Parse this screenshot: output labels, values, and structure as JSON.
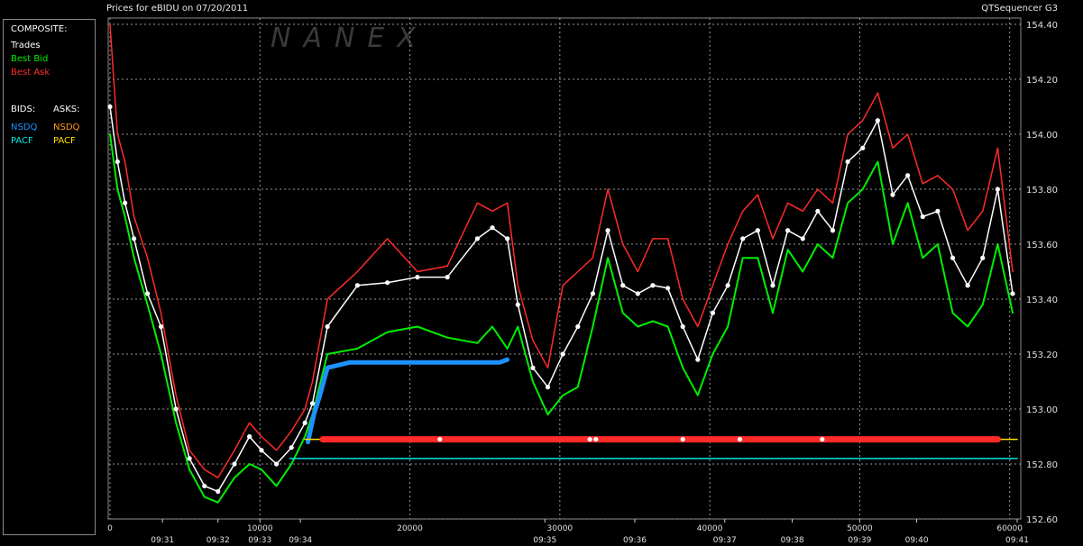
{
  "window": {
    "title": "Prices for  eBIDU  on  07/20/2011",
    "app_name": "QTSequencer G3"
  },
  "legend_panel": {
    "composite_header": "COMPOSITE:",
    "composite_items": [
      {
        "label": "Trades",
        "color": "#ffffff"
      },
      {
        "label": "Best Bid",
        "color": "#00ee00"
      },
      {
        "label": "Best Ask",
        "color": "#ff2a2a"
      }
    ],
    "bids_header": "BIDS:",
    "asks_header": "ASKS:",
    "bids": [
      {
        "label": "NSDQ",
        "color": "#1e90ff"
      },
      {
        "label": "PACF",
        "color": "#00e5e5"
      }
    ],
    "asks": [
      {
        "label": "NSDQ",
        "color": "#ff9a1a"
      },
      {
        "label": "PACF",
        "color": "#ffe000"
      }
    ]
  },
  "watermark": "NANEX",
  "colors": {
    "trades": "#ffffff",
    "best_bid": "#00ee00",
    "best_ask": "#ff2a2a",
    "bid_nsdq": "#1e90ff",
    "bid_pacf": "#00e5e5",
    "ask_nsdq": "#ff9a1a",
    "ask_pacf": "#ffe000",
    "grid": "#9a9a9a"
  },
  "chart_data": {
    "type": "line",
    "grid": true,
    "y_ticks": [
      "154.40",
      "154.20",
      "154.00",
      "153.80",
      "153.60",
      "153.40",
      "153.20",
      "153.00",
      "152.80",
      "152.60"
    ],
    "ylim": [
      152.6,
      154.4
    ],
    "x_ticks": [
      "0",
      "10000",
      "20000",
      "30000",
      "40000",
      "50000",
      "60000"
    ],
    "xlim": [
      0,
      60500
    ],
    "time_labels": [
      {
        "x": 3500,
        "label": "09:31"
      },
      {
        "x": 7200,
        "label": "09:32"
      },
      {
        "x": 10000,
        "label": "09:33"
      },
      {
        "x": 12700,
        "label": "09:34"
      },
      {
        "x": 29000,
        "label": "09:35"
      },
      {
        "x": 35000,
        "label": "09:36"
      },
      {
        "x": 41000,
        "label": "09:37"
      },
      {
        "x": 45500,
        "label": "09:38"
      },
      {
        "x": 50000,
        "label": "09:39"
      },
      {
        "x": 53800,
        "label": "09:40"
      },
      {
        "x": 60500,
        "label": "09:41"
      }
    ],
    "series": [
      {
        "name": "Best Ask",
        "x": [
          0,
          500,
          1000,
          1600,
          2500,
          3400,
          4400,
          5300,
          6300,
          7200,
          8300,
          9300,
          10100,
          11100,
          12100,
          13000,
          13500,
          14500,
          16500,
          18500,
          20500,
          22500,
          24500,
          25500,
          26500,
          27200,
          28200,
          29200,
          30200,
          31200,
          32200,
          33200,
          34200,
          35200,
          36200,
          37200,
          38200,
          39200,
          40200,
          41200,
          42200,
          43200,
          44200,
          45200,
          46200,
          47200,
          48200,
          49200,
          50200,
          51200,
          52200,
          53200,
          54200,
          55200,
          56200,
          57200,
          58200,
          59200,
          60200
        ],
        "values": [
          154.4,
          154.0,
          153.9,
          153.7,
          153.55,
          153.35,
          153.05,
          152.85,
          152.78,
          152.75,
          152.85,
          152.95,
          152.9,
          152.85,
          152.92,
          153.0,
          153.1,
          153.4,
          153.5,
          153.62,
          153.5,
          153.52,
          153.75,
          153.72,
          153.75,
          153.45,
          153.25,
          153.15,
          153.45,
          153.5,
          153.55,
          153.8,
          153.6,
          153.5,
          153.62,
          153.62,
          153.4,
          153.3,
          153.45,
          153.6,
          153.72,
          153.78,
          153.62,
          153.75,
          153.72,
          153.8,
          153.75,
          154.0,
          154.05,
          154.15,
          153.95,
          154.0,
          153.82,
          153.85,
          153.8,
          153.65,
          153.72,
          153.95,
          153.5
        ]
      },
      {
        "name": "Best Bid",
        "x": [
          0,
          500,
          1000,
          1600,
          2500,
          3400,
          4400,
          5300,
          6300,
          7200,
          8300,
          9300,
          10100,
          11100,
          12100,
          13000,
          13500,
          14500,
          16500,
          18500,
          20500,
          22500,
          24500,
          25500,
          26500,
          27200,
          28200,
          29200,
          30200,
          31200,
          32200,
          33200,
          34200,
          35200,
          36200,
          37200,
          38200,
          39200,
          40200,
          41200,
          42200,
          43200,
          44200,
          45200,
          46200,
          47200,
          48200,
          49200,
          50200,
          51200,
          52200,
          53200,
          54200,
          55200,
          56200,
          57200,
          58200,
          59200,
          60200
        ],
        "values": [
          154.0,
          153.8,
          153.7,
          153.55,
          153.38,
          153.2,
          152.95,
          152.78,
          152.68,
          152.66,
          152.75,
          152.8,
          152.78,
          152.72,
          152.8,
          152.9,
          152.98,
          153.2,
          153.22,
          153.28,
          153.3,
          153.26,
          153.24,
          153.3,
          153.22,
          153.3,
          153.1,
          152.98,
          153.05,
          153.08,
          153.3,
          153.55,
          153.35,
          153.3,
          153.32,
          153.3,
          153.15,
          153.05,
          153.2,
          153.3,
          153.55,
          153.55,
          153.35,
          153.58,
          153.5,
          153.6,
          153.55,
          153.75,
          153.8,
          153.9,
          153.6,
          153.75,
          153.55,
          153.6,
          153.35,
          153.3,
          153.38,
          153.6,
          153.35
        ]
      },
      {
        "name": "Trades",
        "x": [
          0,
          500,
          1000,
          1600,
          2500,
          3400,
          4400,
          5300,
          6300,
          7200,
          8300,
          9300,
          10100,
          11100,
          12100,
          13000,
          13500,
          14500,
          16500,
          18500,
          20500,
          22500,
          24500,
          25500,
          26500,
          27200,
          28200,
          29200,
          30200,
          31200,
          32200,
          33200,
          34200,
          35200,
          36200,
          37200,
          38200,
          39200,
          40200,
          41200,
          42200,
          43200,
          44200,
          45200,
          46200,
          47200,
          48200,
          49200,
          50200,
          51200,
          52200,
          53200,
          54200,
          55200,
          56200,
          57200,
          58200,
          59200,
          60200
        ],
        "values": [
          154.1,
          153.9,
          153.75,
          153.62,
          153.42,
          153.3,
          153.0,
          152.82,
          152.72,
          152.7,
          152.8,
          152.9,
          152.85,
          152.8,
          152.86,
          152.95,
          153.02,
          153.3,
          153.45,
          153.46,
          153.48,
          153.48,
          153.62,
          153.66,
          153.62,
          153.38,
          153.15,
          153.08,
          153.2,
          153.3,
          153.42,
          153.65,
          153.45,
          153.42,
          153.45,
          153.44,
          153.3,
          153.18,
          153.35,
          153.45,
          153.62,
          153.65,
          153.45,
          153.65,
          153.62,
          153.72,
          153.65,
          153.9,
          153.95,
          154.05,
          153.78,
          153.85,
          153.7,
          153.72,
          153.55,
          153.45,
          153.55,
          153.8,
          153.42
        ]
      },
      {
        "name": "NSDQ",
        "side": "bid",
        "x": [
          13200,
          13600,
          14000,
          14500,
          16000,
          20000,
          24000,
          26000,
          26500
        ],
        "values": [
          152.88,
          152.98,
          153.05,
          153.15,
          153.17,
          153.17,
          153.17,
          153.17,
          153.18
        ]
      },
      {
        "name": "PACF",
        "side": "bid",
        "x": [
          12000,
          14000,
          20000,
          30000,
          40000,
          50000,
          60500
        ],
        "values": [
          152.82,
          152.82,
          152.82,
          152.82,
          152.82,
          152.82,
          152.82
        ]
      },
      {
        "name": "PACF",
        "side": "ask",
        "x": [
          13000,
          20000,
          30000,
          40000,
          50000,
          58000,
          60500
        ],
        "values": [
          152.89,
          152.89,
          152.89,
          152.89,
          152.89,
          152.89,
          152.89
        ]
      },
      {
        "name": "Best Ask",
        "x": [
          14200,
          59200
        ],
        "values": [
          152.89,
          152.89
        ]
      },
      {
        "name": "Trades",
        "x": [
          22000,
          32000,
          32400,
          38200,
          42000,
          47500
        ],
        "values": [
          152.89,
          152.89,
          152.89,
          152.89,
          152.89,
          152.89
        ]
      }
    ]
  }
}
